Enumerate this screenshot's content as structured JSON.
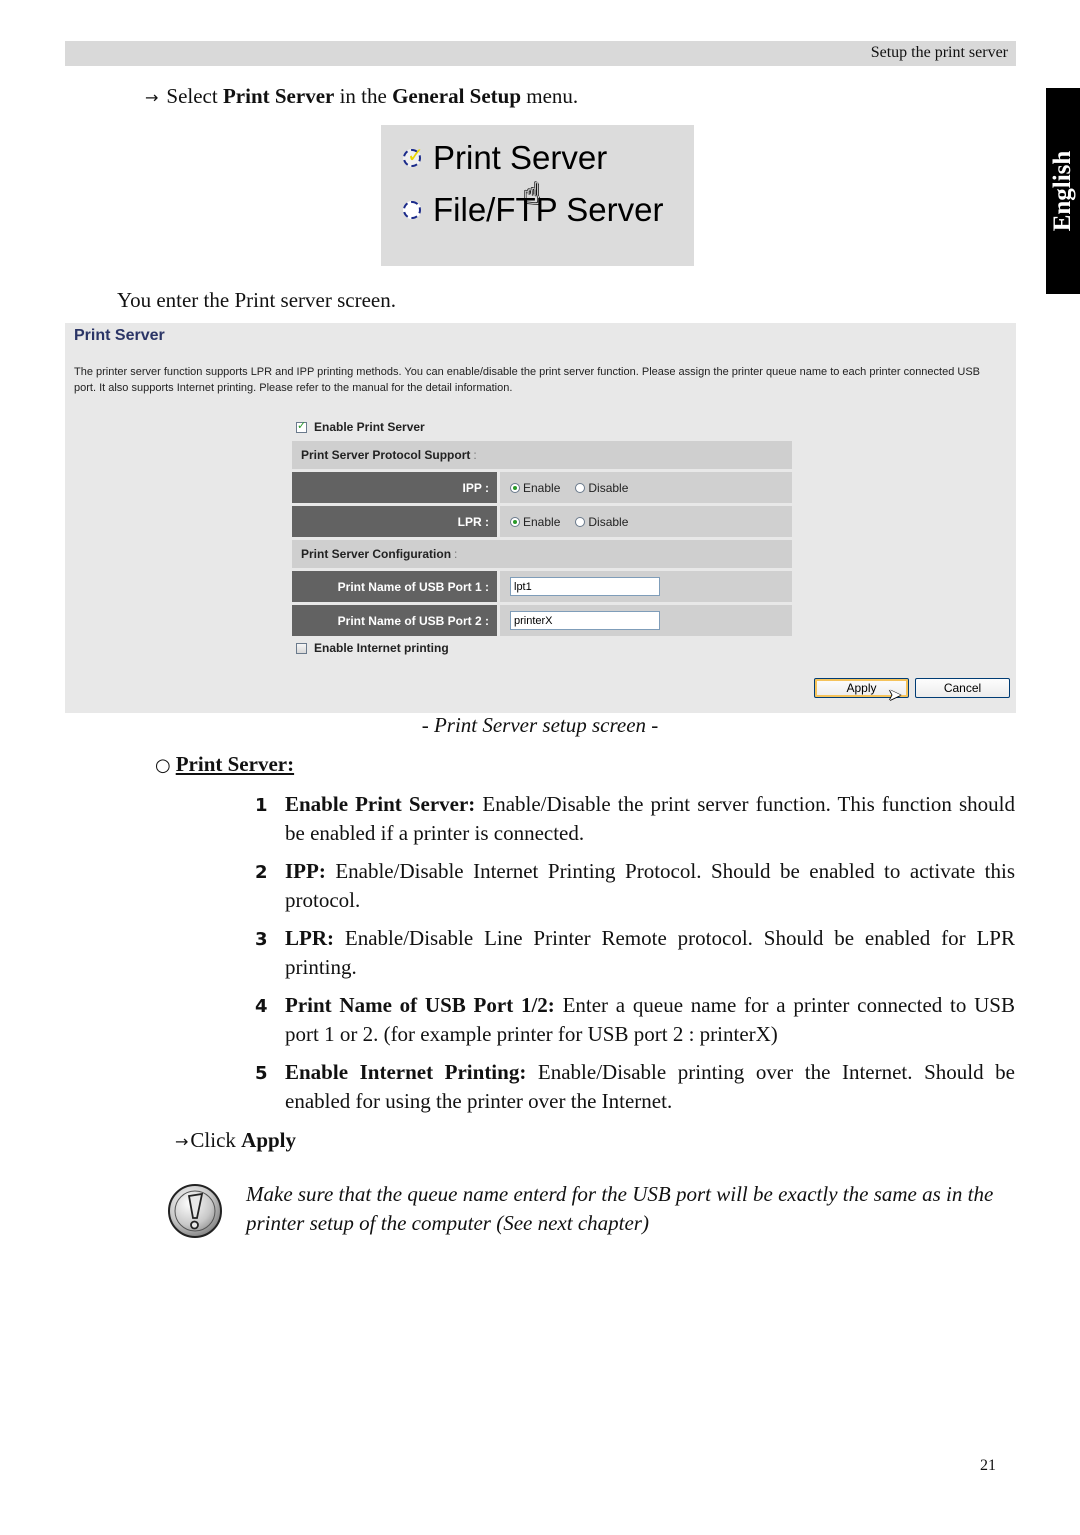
{
  "header": {
    "section_title": "Setup the print server"
  },
  "language_tab": "English",
  "step1": {
    "prefix": "Select ",
    "bold1": "Print Server",
    "mid": " in the ",
    "bold2": "General Setup",
    "suffix": " menu."
  },
  "menu_screenshot": {
    "items": [
      {
        "label": "Print Server",
        "selected": true
      },
      {
        "label": "File/FTP Server",
        "selected": false
      }
    ]
  },
  "enter_text": "You enter the Print server screen.",
  "screen": {
    "title": "Print Server",
    "description": "The printer server function supports LPR and IPP printing methods. You can enable/disable the print server function. Please assign the printer queue name to each printer connected USB port. It also supports Internet printing. Please refer to the manual for the detail information.",
    "enable_print_server": {
      "label": "Enable Print Server",
      "checked": true
    },
    "protocol_section": {
      "label": "Print Server Protocol Support",
      "colon": ":"
    },
    "ipp": {
      "label": "IPP :",
      "enable": "Enable",
      "disable": "Disable",
      "value": "Enable"
    },
    "lpr": {
      "label": "LPR :",
      "enable": "Enable",
      "disable": "Disable",
      "value": "Enable"
    },
    "config_section": {
      "label": "Print Server Configuration",
      "colon": ":"
    },
    "usb1": {
      "label": "Print Name of USB Port 1 :",
      "value": "lpt1"
    },
    "usb2": {
      "label": "Print Name of USB Port 2 :",
      "value": "printerX"
    },
    "internet_printing": {
      "label": "Enable Internet printing",
      "checked": false
    },
    "apply_label": "Apply",
    "cancel_label": "Cancel"
  },
  "caption": "- Print Server setup screen -",
  "section_heading": "Print Server:",
  "items": [
    {
      "num": "1",
      "term": "Enable Print Server:",
      "text": " Enable/Disable the print server function. This function should be enabled if a printer is connected."
    },
    {
      "num": "2",
      "term": "IPP:",
      "text": " Enable/Disable Internet Printing Protocol. Should be enabled to activate this protocol."
    },
    {
      "num": "3",
      "term": "LPR:",
      "text": " Enable/Disable Line Printer Remote protocol. Should be enabled for LPR printing."
    },
    {
      "num": "4",
      "term": "Print Name of USB Port 1/2:",
      "text": " Enter a queue name for a printer connected to USB port 1 or 2. (for example printer for USB port 2 : printerX)"
    },
    {
      "num": "5",
      "term": "Enable Internet Printing:",
      "text": " Enable/Disable printing over the Internet. Should be enabled for using the printer over the Internet."
    }
  ],
  "click_step": {
    "prefix": "Click ",
    "bold": "Apply"
  },
  "note": "Make sure that the queue name enterd for the USB port will be exactly the same as in the printer setup of the computer (See next chapter)",
  "page_number": "21"
}
